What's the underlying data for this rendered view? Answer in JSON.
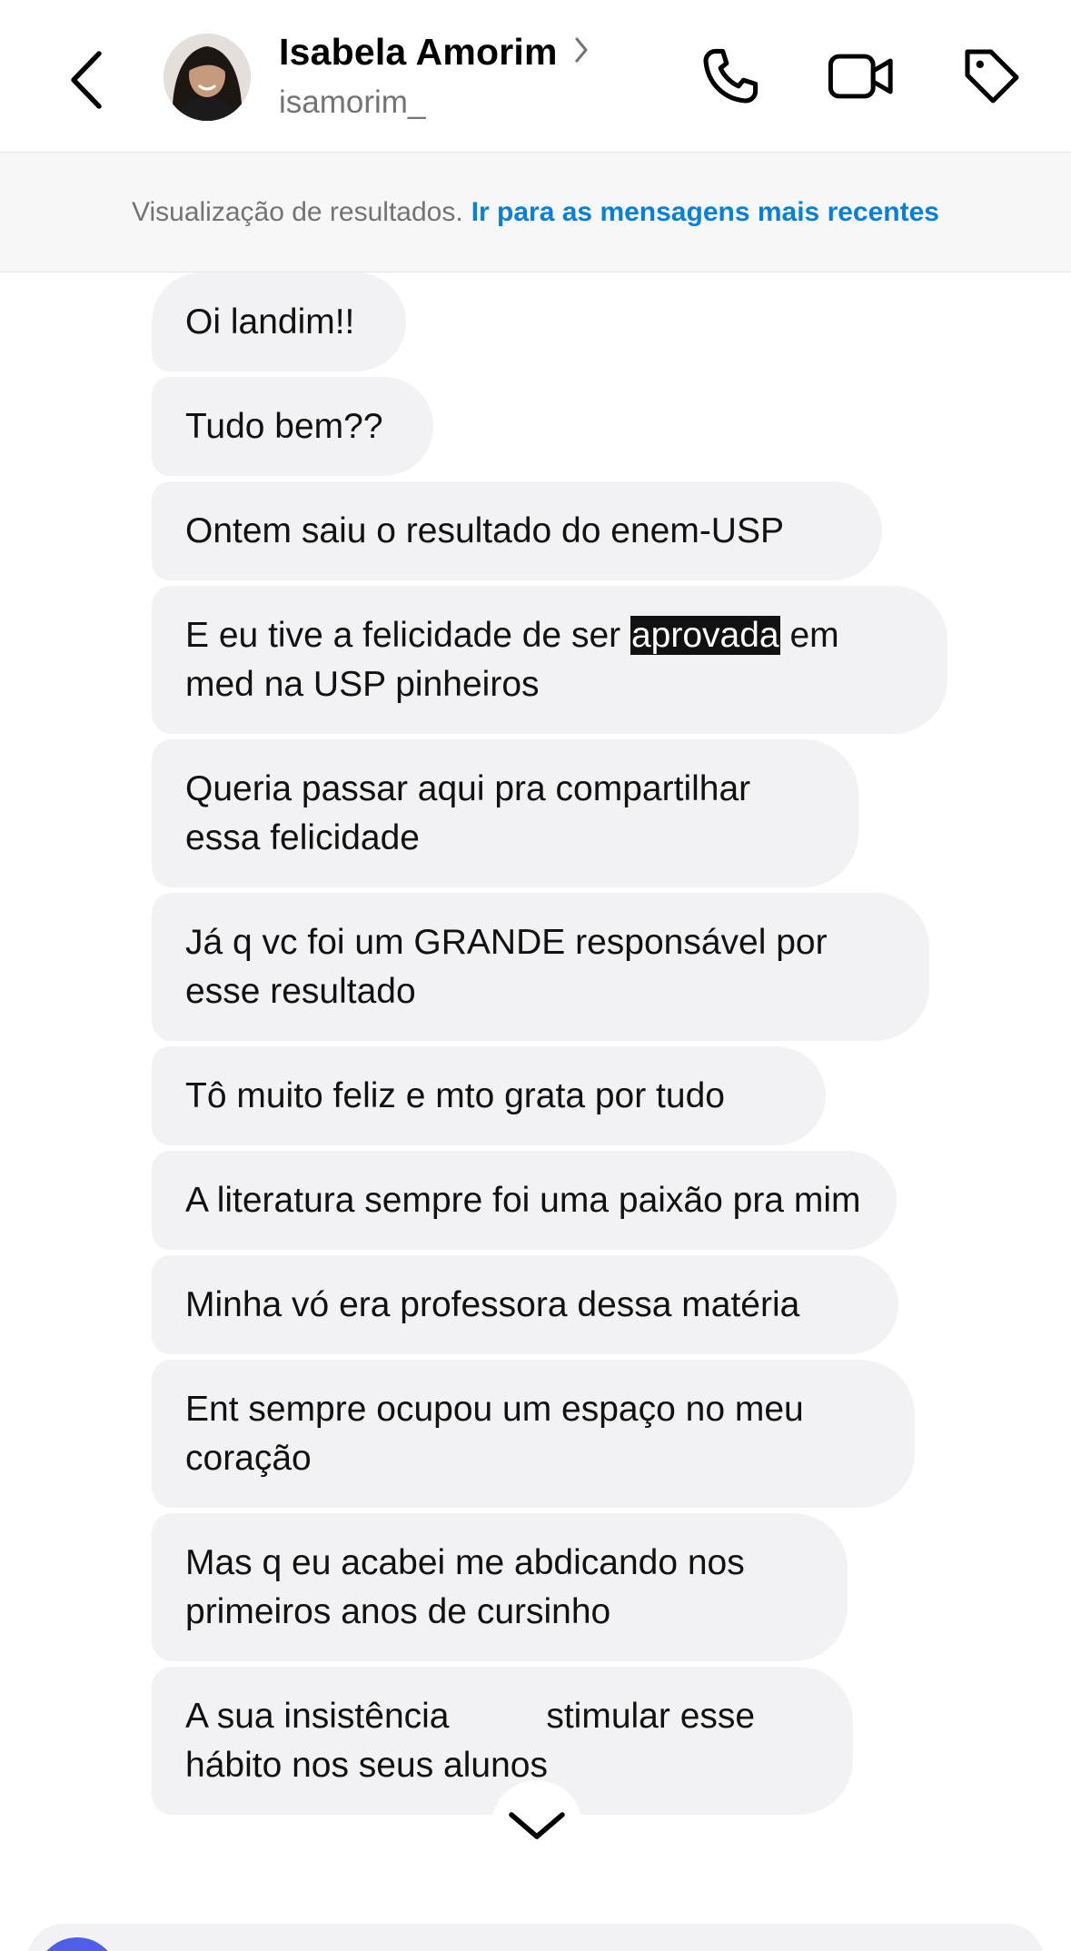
{
  "header": {
    "contact_name": "Isabela Amorim",
    "username": "isamorim_",
    "icons": [
      "back-chevron-icon",
      "chevron-right-icon",
      "phone-icon",
      "video-camera-icon",
      "tag-icon"
    ]
  },
  "banner": {
    "text": "Visualização de resultados.",
    "link": "Ir para as mensagens mais recentes"
  },
  "messages": [
    {
      "text": "Oi landim!!"
    },
    {
      "text": "Tudo bem??"
    },
    {
      "text": "Ontem saiu o resultado do enem-USP"
    },
    {
      "pre": "E eu tive a felicidade de ser ",
      "highlight": "aprovada",
      "post": " em med na USP pinheiros"
    },
    {
      "text": "Queria passar aqui pra compartilhar essa felicidade"
    },
    {
      "text": "Já q vc foi um GRANDE responsável por esse resultado"
    },
    {
      "text": "Tô muito feliz e mto grata por tudo"
    },
    {
      "text": "A literatura sempre foi uma paixão pra mim"
    },
    {
      "text": "Minha vó era professora dessa matéria"
    },
    {
      "text": "Ent sempre ocupou um espaço no meu coração"
    },
    {
      "text": "Mas q eu acabei me abdicando nos primeiros anos de cursinho"
    },
    {
      "line1_a": "A sua insistência ",
      "line1_b": "stimular esse",
      "line2": "hábito nos seus alunos"
    }
  ],
  "colors": {
    "link": "#0a7fd8",
    "bubble_bg": "#f2f2f4",
    "highlight_bg": "#111111",
    "composer_accent": "#4f5de8"
  }
}
